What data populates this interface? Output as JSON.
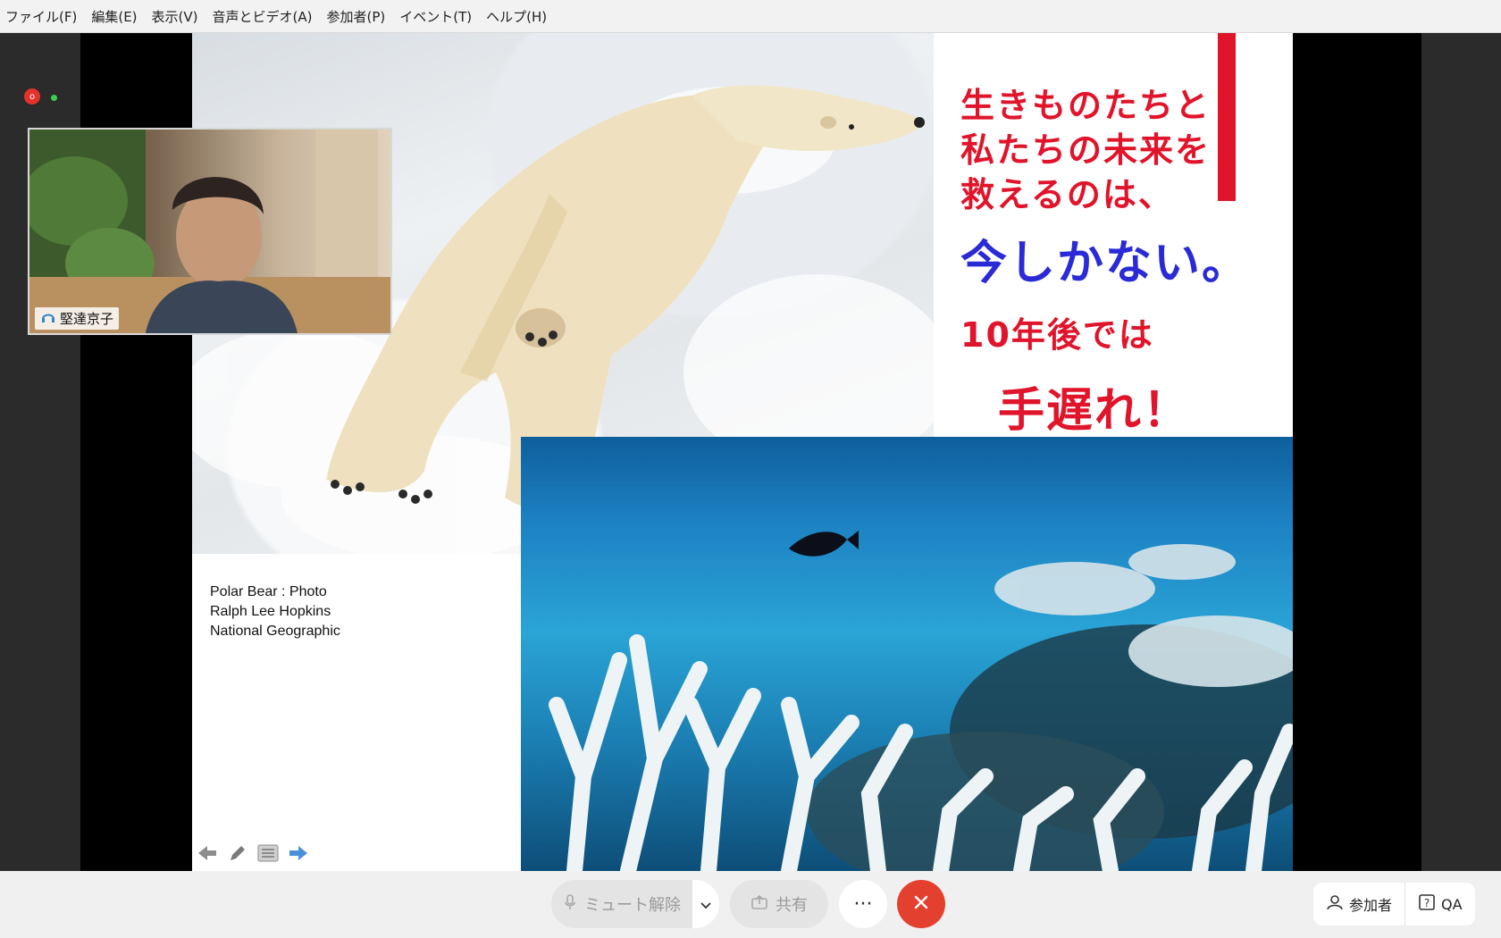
{
  "menu": [
    "ファイル(F)",
    "編集(E)",
    "表示(V)",
    "音声とビデオ(A)",
    "参加者(P)",
    "イベント(T)",
    "ヘルプ(H)"
  ],
  "recording": {
    "indicator": "o"
  },
  "video": {
    "participant_name": "堅達京子"
  },
  "slide": {
    "lines": [
      "生きものたちと",
      "私たちの未来を",
      "救えるのは、",
      "今しかない。",
      "10年後では",
      "手遅れ！"
    ],
    "credit": [
      "Polar Bear : Photo",
      "Ralph Lee Hopkins",
      "National Geographic"
    ],
    "colors": {
      "red": "#e0142a",
      "blue": "#2a2ad6"
    }
  },
  "controls": {
    "icons": [
      "arrow-left-icon",
      "pen-icon",
      "menu-icon",
      "arrow-right-icon"
    ]
  },
  "bottombar": {
    "unmute_label": "ミュート解除",
    "share_label": "共有",
    "more_label": "···",
    "participants_label": "参加者",
    "qa_label": "QA"
  }
}
